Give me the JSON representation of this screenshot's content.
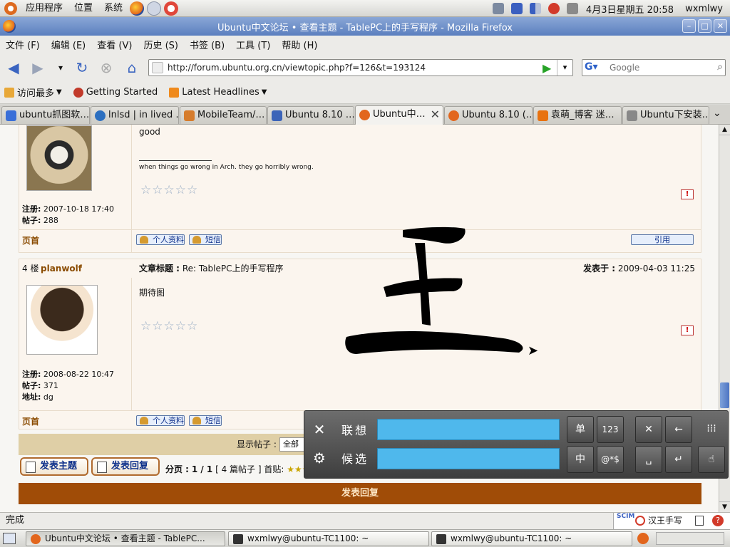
{
  "top_panel": {
    "menus": [
      "应用程序",
      "位置",
      "系统"
    ],
    "clock": "4月3日星期五 20:58",
    "user": "wxmlwy"
  },
  "window": {
    "title": "Ubuntu中文论坛 • 查看主题 - TablePC上的手写程序 - Mozilla Firefox"
  },
  "menubar": [
    "文件 (F)",
    "编辑 (E)",
    "查看 (V)",
    "历史 (S)",
    "书签 (B)",
    "工具 (T)",
    "帮助 (H)"
  ],
  "navbar": {
    "url": "http://forum.ubuntu.org.cn/viewtopic.php?f=126&t=193124",
    "search_placeholder": "Google"
  },
  "bookmarks": [
    "访问最多",
    "Getting Started",
    "Latest Headlines"
  ],
  "tabs": [
    {
      "label": "ubuntu抓图软…",
      "color": "#3a6fd8"
    },
    {
      "label": "lnlsd | in lived …",
      "color": "#2c6fc0"
    },
    {
      "label": "MobileTeam/…",
      "color": "#d67c2c"
    },
    {
      "label": "Ubuntu 8.10 …",
      "color": "#3c64b8"
    },
    {
      "label": "Ubuntu中…",
      "color": "#e2661d"
    },
    {
      "label": "Ubuntu 8.10 (…",
      "color": "#e2661d"
    },
    {
      "label": "袁萌_博客 迷…",
      "color": "#e8720f"
    },
    {
      "label": "Ubuntu下安装…",
      "color": "#888888"
    }
  ],
  "post1": {
    "body": "good",
    "signature": "when things go wrong in Arch. they go horribly wrong.",
    "reg_label": "注册:",
    "reg_date": "2007-10-18 17:40",
    "posts_label": "帖子:",
    "posts": "288",
    "top_link": "页首",
    "profile_btn": "个人资料",
    "pm_btn": "短信",
    "quote_btn": "引用",
    "stars": "☆☆☆☆☆",
    "report": "!"
  },
  "post2": {
    "floor": "4 楼",
    "author": "planwolf",
    "subject_label": "文章标题 :",
    "subject": "Re: TablePC上的手写程序",
    "posted_label": "发表于 :",
    "posted": "2009-04-03 11:25",
    "body": "期待图",
    "reg_label": "注册:",
    "reg_date": "2008-08-22 10:47",
    "posts_label": "帖子:",
    "posts": "371",
    "loc_label": "地址:",
    "location": "dg",
    "top_link": "页首",
    "profile_btn": "个人资料",
    "pm_btn": "短信",
    "stars": "☆☆☆☆☆",
    "report": "!"
  },
  "footer": {
    "display_label": "显示帖子 :",
    "display_value": "全部",
    "new_topic": "发表主题",
    "reply": "发表回复",
    "pager_prefix": "分页 :",
    "page_info": "1 / 1",
    "count": "[ 4 篇帖子 ]",
    "first_page": "首贴:",
    "reply_bar": "发表回复"
  },
  "ime": {
    "assoc_label": "联想",
    "cand_label": "候选",
    "keys": {
      "single": "单",
      "num": "123",
      "zh": "中",
      "sym": "@*$"
    }
  },
  "status": {
    "text": "完成",
    "ime_name": "汉王手写",
    "ime_logo": "SCIM"
  },
  "taskbar": [
    "Ubuntu中文论坛 • 查看主题 - TablePC...",
    "wxmlwy@ubuntu-TC1100: ~",
    "wxmlwy@ubuntu-TC1100: ~"
  ]
}
